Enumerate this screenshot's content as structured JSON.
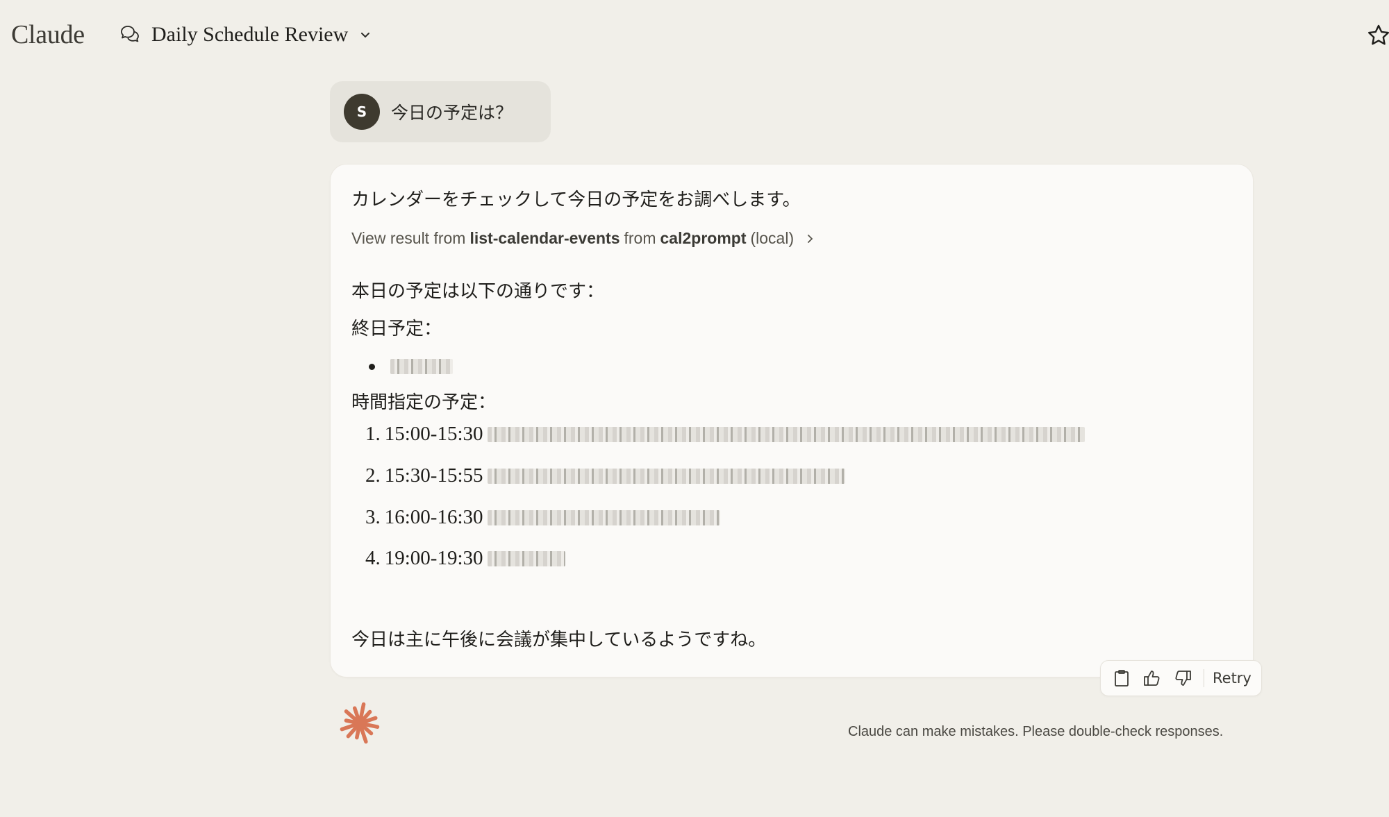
{
  "header": {
    "brand": "Claude",
    "chat_title": "Daily Schedule Review",
    "icons": {
      "chat": "chat-bubbles-icon",
      "dropdown": "chevron-down-icon",
      "star": "star-icon"
    }
  },
  "user_message": {
    "avatar_initial": "S",
    "text": "今日の予定は？"
  },
  "response": {
    "intro": "カレンダーをチェックして今日の予定をお調べします。",
    "tool_result": {
      "prefix": "View result from",
      "tool": "list-calendar-events",
      "middle": "from",
      "server": "cal2prompt",
      "suffix": "(local)"
    },
    "lead": "本日の予定は以下の通りです：",
    "all_day_heading": "終日予定：",
    "all_day_items": [
      {
        "text": "[redacted]"
      }
    ],
    "timed_heading": "時間指定の予定：",
    "timed_items": [
      {
        "number": "1.",
        "time": "15:00-15:30",
        "title": "[redacted]"
      },
      {
        "number": "2.",
        "time": "15:30-15:55",
        "title": "[redacted]"
      },
      {
        "number": "3.",
        "time": "16:00-16:30",
        "title": "[redacted]"
      },
      {
        "number": "4.",
        "time": "19:00-19:30",
        "title": "[redacted]"
      }
    ],
    "closing": "今日は主に午後に会議が集中しているようですね。"
  },
  "actions": {
    "copy": "clipboard-icon",
    "thumbs_up": "thumbs-up-icon",
    "thumbs_down": "thumbs-down-icon",
    "retry_label": "Retry"
  },
  "footer": {
    "disclaimer": "Claude can make mistakes. Please double-check responses.",
    "accent_color": "#d97757"
  }
}
